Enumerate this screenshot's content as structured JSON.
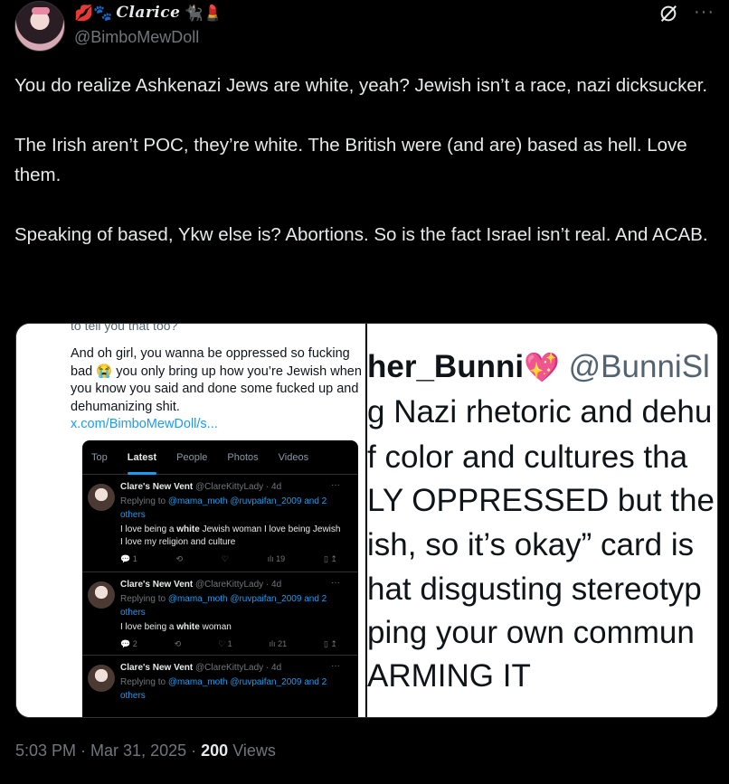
{
  "user": {
    "display_name": "Clarice",
    "handle": "@BimboMewDoll",
    "emoji_left": "💋🐾",
    "emoji_right": "🐈‍⬛💄"
  },
  "tweet": {
    "paragraphs": [
      "You do realize Ashkenazi Jews are white, yeah?  Jewish isn’t a race, nazi dicksucker.",
      "The Irish aren’t POC, they’re white.  The British were (and are) based as hell.  Love them.",
      "Speaking of based, Ykw else is?  Abortions.  So is the fact Israel isn’t real.  And ACAB."
    ]
  },
  "media": {
    "left": {
      "cut_top_text": "to tell you that too?",
      "quote_text": "And oh girl, you wanna be oppressed so fucking bad 😭 you only bring up how you’re Jewish when you know you said and done some fucked up and dehumanizing shit.",
      "quote_link": "x.com/BimboMewDoll/s...",
      "tabs": [
        "Top",
        "Latest",
        "People",
        "Photos",
        "Videos"
      ],
      "mini_tweets": [
        {
          "name": "Clare's New Vent",
          "meta": "@ClareKittyLady · 4d",
          "replying_prefix": "Replying to",
          "replying_to": "@mama_moth @ruvpaifan_2009 and 2 others",
          "body": "I love being a white Jewish woman I love being Jewish I love my religion and culture",
          "replies": "1",
          "retweets": "",
          "likes": "",
          "views": "19"
        },
        {
          "name": "Clare's New Vent",
          "meta": "@ClareKittyLady · 4d",
          "replying_prefix": "Replying to",
          "replying_to": "@mama_moth @ruvpaifan_2009 and 2 others",
          "body": "I love being a white woman",
          "replies": "2",
          "retweets": "",
          "likes": "1",
          "views": "21"
        },
        {
          "name": "Clare's New Vent",
          "meta": "@ClareKittyLady · 4d",
          "replying_prefix": "Replying to",
          "replying_to": "@mama_moth @ruvpaifan_2009 and 2 others",
          "body": "",
          "replies": "",
          "retweets": "",
          "likes": "",
          "views": ""
        }
      ]
    },
    "right": {
      "name_fragment": "her_Bunni",
      "handle_fragment": "@BunniSl",
      "lines": [
        "g Nazi rhetoric and dehu",
        "f color and cultures tha",
        "LY OPPRESSED but the",
        "ish, so it’s okay” card is",
        "hat disgusting stereotyp",
        "ping your own commun",
        "ARMING IT"
      ]
    }
  },
  "footer": {
    "time": "5:03 PM",
    "date": "Mar 31, 2025",
    "views_count": "200",
    "views_label": "Views"
  }
}
